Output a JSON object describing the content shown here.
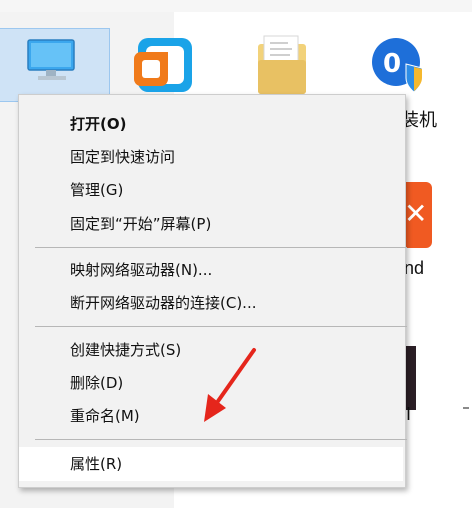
{
  "desktop": {
    "peek_labels": [
      "装机",
      "nd",
      "I"
    ]
  },
  "context_menu": {
    "items": [
      {
        "label": "打开(O)",
        "bold": true
      },
      {
        "label": "固定到快速访问"
      },
      {
        "label": "管理(G)"
      },
      {
        "label": "固定到“开始”屏幕(P)"
      },
      {
        "label": "映射网络驱动器(N)..."
      },
      {
        "label": "断开网络驱动器的连接(C)..."
      },
      {
        "label": "创建快捷方式(S)"
      },
      {
        "label": "删除(D)"
      },
      {
        "label": "重命名(M)"
      },
      {
        "label": "属性(R)",
        "highlighted": true
      }
    ]
  },
  "colors": {
    "menu_bg": "#f2f2f2",
    "highlight": "#ffffff",
    "annotation_arrow": "#e5261c",
    "selection_bg": "#cfe3f6"
  }
}
